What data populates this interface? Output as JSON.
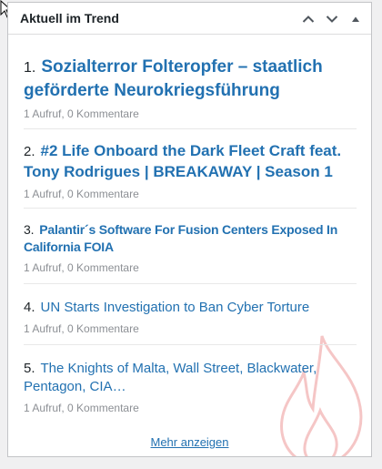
{
  "widget": {
    "title": "Aktuell im Trend"
  },
  "icons": {
    "cursor": "mouse-pointer-icon",
    "move_up": "chevron-up-icon",
    "move_down": "chevron-down-icon",
    "toggle": "triangle-up-icon",
    "background": "flame-icon"
  },
  "colors": {
    "link": "#2271b1",
    "meta": "#8c8f94",
    "flame": "#f5c6c6"
  },
  "items": [
    {
      "number": "1.",
      "title": "Sozialterror Folteropfer – staatlich geförderte Neurokriegsführung",
      "views": "1 Aufruf",
      "comments": "0 Kommentare"
    },
    {
      "number": "2.",
      "title": "#2 Life Onboard the Dark Fleet Craft feat. Tony Rodrigues | BREAKAWAY | Season 1",
      "views": "1 Aufruf",
      "comments": "0 Kommentare"
    },
    {
      "number": "3.",
      "title": "Palantir´s Software For Fusion Centers Exposed In California FOIA",
      "views": "1 Aufruf",
      "comments": "0 Kommentare"
    },
    {
      "number": "4.",
      "title": "UN Starts Investigation to Ban Cyber Torture",
      "views": "1 Aufruf",
      "comments": "0 Kommentare"
    },
    {
      "number": "5.",
      "title": "The Knights of Malta, Wall Street, Blackwater, Pentagon, CIA…",
      "views": "1 Aufruf",
      "comments": "0 Kommentare"
    }
  ],
  "more_link": "Mehr anzeigen"
}
